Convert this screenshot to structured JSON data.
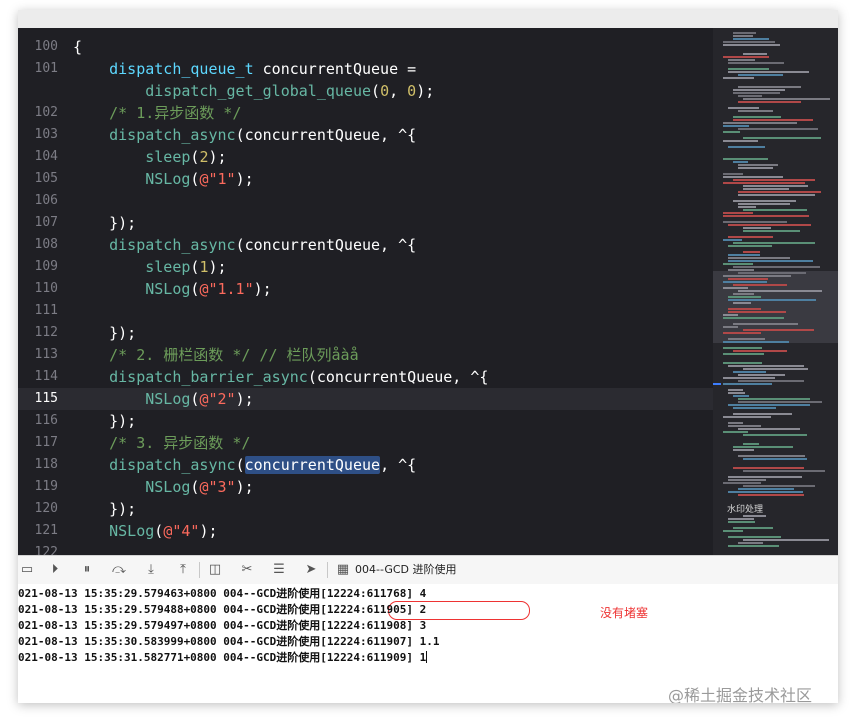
{
  "editor": {
    "lines": [
      {
        "num": "100",
        "html": "{"
      },
      {
        "num": "101",
        "html": "    <span class='kw-type'>dispatch_queue_t</span> concurrentQueue ="
      },
      {
        "num": "",
        "html": "        <span class='fn'>dispatch_get_global_queue</span>(<span class='num'>0</span>, <span class='num'>0</span>);"
      },
      {
        "num": "102",
        "html": "    <span class='cm'>/* 1.异步函数 */</span>"
      },
      {
        "num": "103",
        "html": "    <span class='fn'>dispatch_async</span>(concurrentQueue, ^{"
      },
      {
        "num": "104",
        "html": "        <span class='fn'>sleep</span>(<span class='num'>2</span>);"
      },
      {
        "num": "105",
        "html": "        <span class='fn'>NSLog</span>(<span class='str'>@\"1\"</span>);"
      },
      {
        "num": "106",
        "html": ""
      },
      {
        "num": "107",
        "html": "    });"
      },
      {
        "num": "108",
        "html": "    <span class='fn'>dispatch_async</span>(concurrentQueue, ^{"
      },
      {
        "num": "109",
        "html": "        <span class='fn'>sleep</span>(<span class='num'>1</span>);"
      },
      {
        "num": "110",
        "html": "        <span class='fn'>NSLog</span>(<span class='str'>@\"1.1\"</span>);"
      },
      {
        "num": "111",
        "html": ""
      },
      {
        "num": "112",
        "html": "    });"
      },
      {
        "num": "113",
        "html": "    <span class='cm'>/* 2. 栅栏函数 */ // 栏队列åàå</span>"
      },
      {
        "num": "114",
        "html": "    <span class='fn'>dispatch_barrier_async</span>(concurrentQueue, ^{"
      },
      {
        "num": "115",
        "html": "        <span class='fn'>NSLog</span>(<span class='str'>@\"2\"</span>);",
        "current": true
      },
      {
        "num": "116",
        "html": "    });"
      },
      {
        "num": "117",
        "html": "    <span class='cm'>/* 3. 异步函数 */</span>"
      },
      {
        "num": "118",
        "html": "    <span class='fn'>dispatch_async</span>(<span class='hl'>concurrentQueue</span>, ^{"
      },
      {
        "num": "119",
        "html": "        <span class='fn'>NSLog</span>(<span class='str'>@\"3\"</span>);"
      },
      {
        "num": "120",
        "html": "    });"
      },
      {
        "num": "121",
        "html": "    <span class='fn'>NSLog</span>(<span class='str'>@\"4\"</span>);"
      },
      {
        "num": "122",
        "html": ""
      }
    ]
  },
  "minimap": {
    "section_label": "水印处理"
  },
  "toolbar": {
    "icons": [
      "hide-debug-area-icon",
      "breakpoints-icon",
      "pause-icon",
      "step-over-icon",
      "step-into-icon",
      "step-out-icon",
      "view-hierarchy-icon",
      "memory-graph-icon",
      "environment-overrides-icon",
      "simulate-location-icon",
      "scheme-app-icon"
    ],
    "target_label": "004--GCD 进阶使用"
  },
  "console": {
    "lines": [
      "021-08-13 15:35:29.579463+0800 004--GCD进阶使用[12224:611768] 4",
      "021-08-13 15:35:29.579488+0800 004--GCD进阶使用[12224:611905] 2",
      "021-08-13 15:35:29.579497+0800 004--GCD进阶使用[12224:611908] 3",
      "021-08-13 15:35:30.583999+0800 004--GCD进阶使用[12224:611907] 1.1",
      "021-08-13 15:35:31.582771+0800 004--GCD进阶使用[12224:611909] 1"
    ],
    "annotation": "没有堵塞"
  },
  "watermark": "@稀土掘金技术社区",
  "colors": {
    "editor_bg": "#1f1f24",
    "function": "#67b7a4",
    "type": "#5dd8ff",
    "string": "#fc6a5d",
    "number": "#d0bf69",
    "comment": "#6c9c5a",
    "annotation": "#ee3333"
  }
}
